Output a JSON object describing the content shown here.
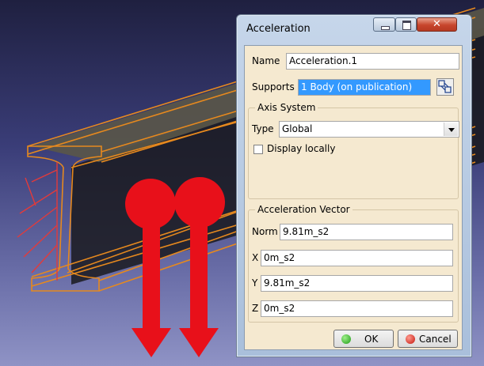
{
  "dialog": {
    "title": "Acceleration",
    "name_label": "Name",
    "name_value": "Acceleration.1",
    "supports_label": "Supports",
    "supports_value": "1 Body (on publication)",
    "axis_group_title": "Axis System",
    "type_label": "Type",
    "type_value": "Global",
    "display_locally_label": "Display locally",
    "display_locally_checked": false,
    "vector_group_title": "Acceleration Vector",
    "norm_label": "Norm",
    "norm_value": "9.81m_s2",
    "x_label": "X",
    "x_value": "0m_s2",
    "y_label": "Y",
    "y_value": "9.81m_s2",
    "z_label": "Z",
    "z_value": "0m_s2",
    "ok_label": "OK",
    "cancel_label": "Cancel"
  },
  "colors": {
    "selection": "#3399ff",
    "beam_wire": "#e6891e",
    "acceleration_arrow": "#e8101a",
    "clamp": "#e33a3a"
  }
}
